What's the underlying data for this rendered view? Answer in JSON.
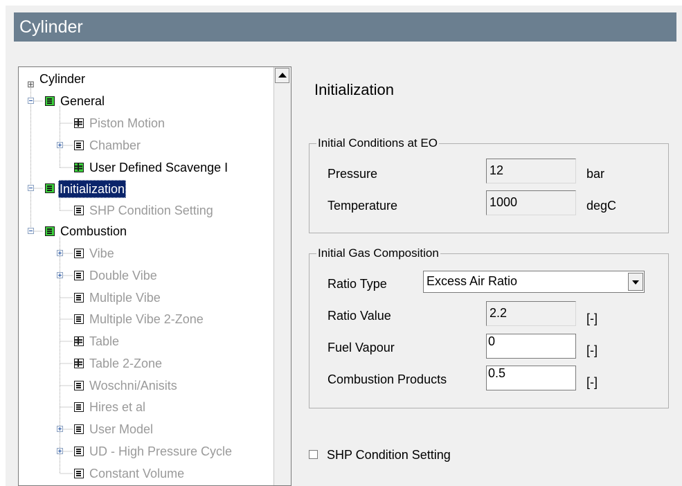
{
  "window": {
    "title": "Cylinder"
  },
  "tree": {
    "root": "Cylinder",
    "items": [
      {
        "label": "General",
        "icon": "green-module-icon",
        "expander": "minus",
        "level": 1,
        "enabled": true
      },
      {
        "label": "Piston Motion",
        "icon": "table-icon",
        "level": 2,
        "enabled": false
      },
      {
        "label": "Chamber",
        "icon": "document-icon",
        "expander": "plus",
        "level": 2,
        "enabled": false
      },
      {
        "label": "User Defined Scavenge I",
        "icon": "green-table-icon",
        "level": 2,
        "enabled": true
      },
      {
        "label": "Initialization",
        "icon": "green-module-icon",
        "expander": "minus",
        "level": 1,
        "enabled": true,
        "selected": true
      },
      {
        "label": "SHP Condition Setting",
        "icon": "document-icon",
        "level": 2,
        "enabled": false
      },
      {
        "label": "Combustion",
        "icon": "green-module-icon",
        "expander": "minus",
        "level": 1,
        "enabled": true
      },
      {
        "label": "Vibe",
        "icon": "document-icon",
        "expander": "plus",
        "level": 2,
        "enabled": false
      },
      {
        "label": "Double Vibe",
        "icon": "document-icon",
        "expander": "plus",
        "level": 2,
        "enabled": false
      },
      {
        "label": "Multiple Vibe",
        "icon": "document-icon",
        "level": 2,
        "enabled": false
      },
      {
        "label": "Multiple Vibe 2-Zone",
        "icon": "document-icon",
        "level": 2,
        "enabled": false
      },
      {
        "label": "Table",
        "icon": "table-icon",
        "level": 2,
        "enabled": false
      },
      {
        "label": "Table 2-Zone",
        "icon": "table-icon",
        "level": 2,
        "enabled": false
      },
      {
        "label": "Woschni/Anisits",
        "icon": "document-icon",
        "level": 2,
        "enabled": false
      },
      {
        "label": "Hires et al",
        "icon": "document-icon",
        "level": 2,
        "enabled": false
      },
      {
        "label": "User Model",
        "icon": "document-icon",
        "expander": "plus",
        "level": 2,
        "enabled": false
      },
      {
        "label": "UD - High Pressure Cycle",
        "icon": "document-icon",
        "expander": "plus",
        "level": 2,
        "enabled": false
      },
      {
        "label": "Constant Volume",
        "icon": "document-icon",
        "level": 2,
        "enabled": false
      }
    ]
  },
  "panel": {
    "title": "Initialization",
    "initial_conditions": {
      "title": "Initial Conditions at EO",
      "pressure": {
        "label": "Pressure",
        "value": "12",
        "unit": "bar"
      },
      "temperature": {
        "label": "Temperature",
        "value": "1000",
        "unit": "degC"
      }
    },
    "gas_composition": {
      "title": "Initial Gas Composition",
      "ratio_type": {
        "label": "Ratio Type",
        "value": "Excess Air Ratio"
      },
      "ratio_value": {
        "label": "Ratio Value",
        "value": "2.2",
        "unit": "[-]"
      },
      "fuel_vapour": {
        "label": "Fuel Vapour",
        "value": "0",
        "unit": "[-]"
      },
      "combustion_products": {
        "label": "Combustion Products",
        "value": "0.5",
        "unit": "[-]"
      }
    },
    "shp_condition": {
      "label": "SHP Condition Setting",
      "checked": false
    }
  },
  "colors": {
    "titlebar": "#6b7f90",
    "selection": "#0a246a",
    "module_green": "#3ccf3c",
    "disabled_text": "#9a9a9a"
  }
}
